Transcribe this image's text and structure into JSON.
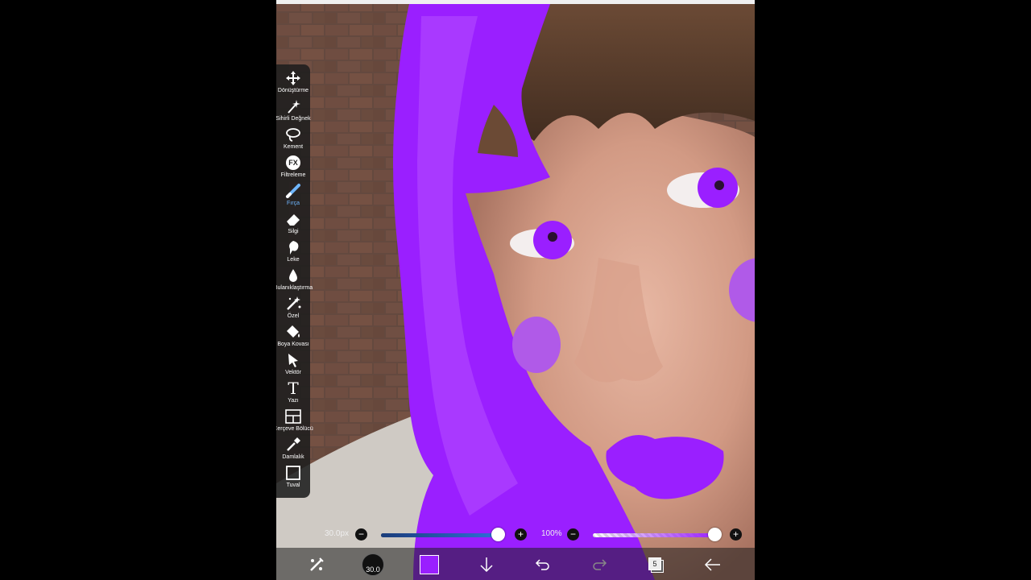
{
  "tools": [
    {
      "label": "Dönüştürme",
      "icon": "move-icon"
    },
    {
      "label": "Sihirli Değnek",
      "icon": "magic-wand-icon"
    },
    {
      "label": "Kement",
      "icon": "lasso-icon"
    },
    {
      "label": "Filtreleme",
      "icon": "fx-icon"
    },
    {
      "label": "Fırça",
      "icon": "brush-icon",
      "active": true
    },
    {
      "label": "Silgi",
      "icon": "eraser-icon"
    },
    {
      "label": "Leke",
      "icon": "smudge-icon"
    },
    {
      "label": "Bulanıklaştırma",
      "icon": "blur-icon"
    },
    {
      "label": "Özel",
      "icon": "special-icon"
    },
    {
      "label": "Boya Kovası",
      "icon": "paint-bucket-icon"
    },
    {
      "label": "Vektör",
      "icon": "vector-icon"
    },
    {
      "label": "Yazı",
      "icon": "text-icon"
    },
    {
      "label": "Çerçeve Bölücü",
      "icon": "frame-divider-icon"
    },
    {
      "label": "Damlalık",
      "icon": "eyedropper-icon"
    },
    {
      "label": "Tuval",
      "icon": "canvas-icon"
    }
  ],
  "fx_glyph": "FX",
  "text_glyph": "T",
  "sliders": {
    "size_value": "30.0px",
    "size_fraction": 1.0,
    "opacity_value": "100%",
    "opacity_fraction": 1.0,
    "minus": "−",
    "plus": "+"
  },
  "bottombar": {
    "brush_size_badge": "30.0",
    "layer_count": "5",
    "current_color": "#9a1fff"
  },
  "colors": {
    "paint_purple": "#9a1fff",
    "light_purple": "#b05ae8",
    "accent_blue": "#6fb6ff"
  }
}
